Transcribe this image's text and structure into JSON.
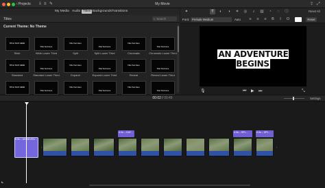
{
  "window": {
    "title": "My Movie",
    "back_label": "Projects"
  },
  "toolbar_right": {
    "reset_all": "Reset All"
  },
  "browser": {
    "tabs": [
      {
        "label": "My Media",
        "active": false
      },
      {
        "label": "Audio",
        "active": false
      },
      {
        "label": "Titles",
        "active": true
      },
      {
        "label": "Backgrounds",
        "active": false
      },
      {
        "label": "Transitions",
        "active": false
      }
    ],
    "section_label": "Titles",
    "search_placeholder": "Search",
    "theme_label": "Current Theme: No Theme",
    "tiles": [
      {
        "name": "Slide",
        "preview": "TITLE TEXT HERE"
      },
      {
        "name": "Wide Lower Third",
        "preview": "Title Text Here"
      },
      {
        "name": "Split",
        "preview": "Title Text Here"
      },
      {
        "name": "Split Lower Third",
        "preview": "Title Text Here"
      },
      {
        "name": "Chromatic",
        "preview": "Title Text Here"
      },
      {
        "name": "Chromatic Lower Third",
        "preview": "Title Text Here"
      },
      {
        "name": "Standard",
        "preview": "TITLE TEXT HERE"
      },
      {
        "name": "Standard Lower Third",
        "preview": "Title Text Here"
      },
      {
        "name": "Expand",
        "preview": "Title Text Here"
      },
      {
        "name": "Expand Lower Third",
        "preview": "Title Text Here"
      },
      {
        "name": "Reveal",
        "preview": "Title Text Here"
      },
      {
        "name": "Reveal Lower Third",
        "preview": "Title Text Here"
      },
      {
        "name": "Focus",
        "preview": "TITLE TEXT HERE"
      },
      {
        "name": "Focus Lower Third",
        "preview": "Title Text Here"
      },
      {
        "name": "Line",
        "preview": "Title Text Here"
      },
      {
        "name": "Line Lower Third",
        "preview": "Title Text Here"
      },
      {
        "name": "Pop-up",
        "preview": "Title Text Here"
      },
      {
        "name": "Pop-up Lower Third",
        "preview": "Title Text Here"
      }
    ]
  },
  "viewer": {
    "font_label": "Font:",
    "font_value": "Prelude Medium",
    "size_value": "Auto",
    "reset_label": "Reset",
    "title_text": "AN ADVENTURE BEGINS",
    "swatch_color": "#ffffff"
  },
  "timeline": {
    "current_time": "00:02",
    "separator": " / ",
    "total_time": "00:49",
    "settings_label": "Settings",
    "first_clip_label": "5.0s – AN ADVEN...",
    "title_clips": [
      {
        "label": "4.0s – CAF..."
      },
      {
        "label": "4.0s – SPL..."
      },
      {
        "label": "4.0s – SPL..."
      }
    ],
    "clip_colors": [
      "#4f6b3a",
      "#5d7a44",
      "#3e5a30",
      "#566e3f",
      "#6b7f50",
      "#4a6636",
      "#7a8a5a",
      "#5c7545",
      "#48633a",
      "#6a7c52",
      "#55703f"
    ]
  }
}
